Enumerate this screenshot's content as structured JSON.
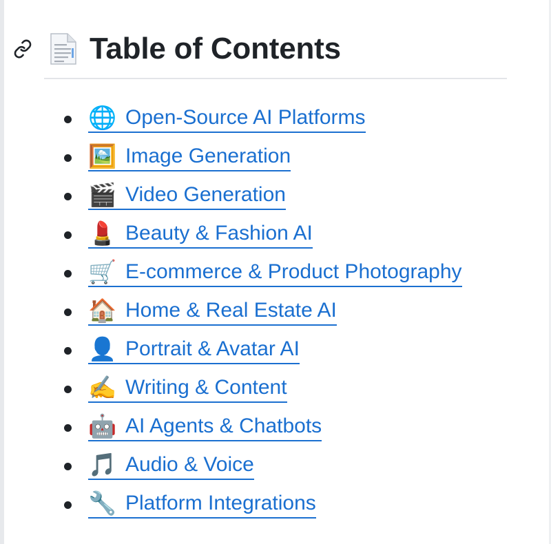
{
  "heading": {
    "title": "Table of Contents",
    "anchor_icon": "link-icon",
    "doc_icon": "page-facing-up-icon"
  },
  "toc": {
    "items": [
      {
        "emoji": "🌐",
        "label": "Open-Source AI Platforms"
      },
      {
        "emoji": "🖼️",
        "label": "Image Generation"
      },
      {
        "emoji": "🎬",
        "label": "Video Generation"
      },
      {
        "emoji": "💄",
        "label": "Beauty & Fashion AI"
      },
      {
        "emoji": "🛒",
        "label": "E-commerce & Product Photography"
      },
      {
        "emoji": "🏠",
        "label": "Home & Real Estate AI"
      },
      {
        "emoji": "👤",
        "label": "Portrait & Avatar AI"
      },
      {
        "emoji": "✍️",
        "label": "Writing & Content"
      },
      {
        "emoji": "🤖",
        "label": "AI Agents & Chatbots"
      },
      {
        "emoji": "🎵",
        "label": "Audio & Voice"
      },
      {
        "emoji": "🔧",
        "label": "Platform Integrations"
      }
    ]
  },
  "colors": {
    "link": "#1a6fd0",
    "text": "#1f2328",
    "rule": "#e3e5e8"
  }
}
